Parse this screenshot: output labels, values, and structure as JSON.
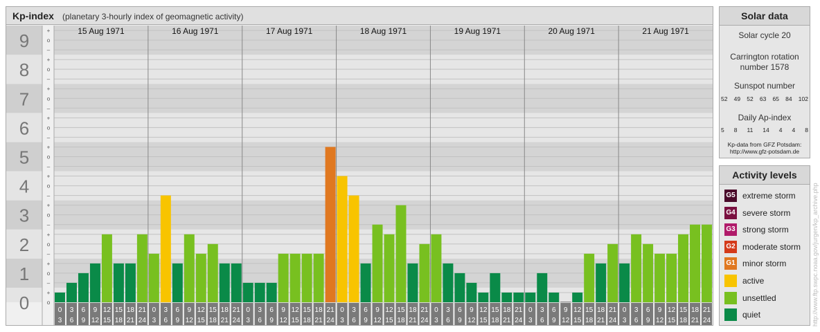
{
  "header": {
    "title": "Kp-index",
    "subtitle": "(planetary 3-hourly index of geomagnetic activity)"
  },
  "solar": {
    "title": "Solar data",
    "cycle": "Solar cycle 20",
    "carrington_line1": "Carrington rotation",
    "carrington_line2": "number 1578",
    "sunspot_title": "Sunspot number",
    "sunspot_values": [
      "52",
      "49",
      "52",
      "63",
      "65",
      "84",
      "102"
    ],
    "ap_title": "Daily Ap-index",
    "ap_values": [
      "5",
      "8",
      "11",
      "14",
      "4",
      "4",
      "8"
    ],
    "credit_line1": "Kp-data from GFZ Potsdam:",
    "credit_line2": "http://www.gfz-potsdam.de"
  },
  "activity": {
    "title": "Activity levels",
    "levels": [
      {
        "code": "G5",
        "label": "extreme storm",
        "color": "#4a0a2a"
      },
      {
        "code": "G4",
        "label": "severe storm",
        "color": "#7a1040"
      },
      {
        "code": "G3",
        "label": "strong storm",
        "color": "#b01a6a"
      },
      {
        "code": "G2",
        "label": "moderate storm",
        "color": "#d43a1a"
      },
      {
        "code": "G1",
        "label": "minor storm",
        "color": "#e07820"
      },
      {
        "code": "",
        "label": "active",
        "color": "#f8c400"
      },
      {
        "code": "",
        "label": "unsettled",
        "color": "#78c020"
      },
      {
        "code": "",
        "label": "quiet",
        "color": "#0a8a48"
      }
    ]
  },
  "watermark": "http://www.ftp.swpc.noaa.gov/jurgen/kp_archive.php",
  "chart_data": {
    "type": "bar",
    "ylim": [
      0,
      9
    ],
    "y_ticks": [
      "0",
      "1",
      "2",
      "3",
      "4",
      "5",
      "6",
      "7",
      "8",
      "9"
    ],
    "minor_tick_labels": [
      "–",
      "o",
      "+"
    ],
    "days": [
      "15 Aug 1971",
      "16 Aug 1971",
      "17 Aug 1971",
      "18 Aug 1971",
      "19 Aug 1971",
      "20 Aug 1971",
      "21 Aug 1971"
    ],
    "interval_start": [
      "0",
      "3",
      "6",
      "9",
      "12",
      "15",
      "18",
      "21"
    ],
    "interval_end": [
      "3",
      "6",
      "9",
      "12",
      "15",
      "18",
      "21",
      "24"
    ],
    "values": [
      0.333,
      0.667,
      1.0,
      1.333,
      2.333,
      1.333,
      1.333,
      2.333,
      1.667,
      3.667,
      1.333,
      2.333,
      1.667,
      2.0,
      1.333,
      1.333,
      0.667,
      0.667,
      0.667,
      1.667,
      1.667,
      1.667,
      1.667,
      5.333,
      4.333,
      3.667,
      1.333,
      2.667,
      2.333,
      3.333,
      1.333,
      2.0,
      2.333,
      1.333,
      1.0,
      0.667,
      0.333,
      1.0,
      0.333,
      0.333,
      0.333,
      1.0,
      0.333,
      0.0,
      0.333,
      1.667,
      1.333,
      2.0,
      1.333,
      2.333,
      2.0,
      1.667,
      1.667,
      2.333,
      2.667,
      2.667
    ],
    "grid": true
  }
}
